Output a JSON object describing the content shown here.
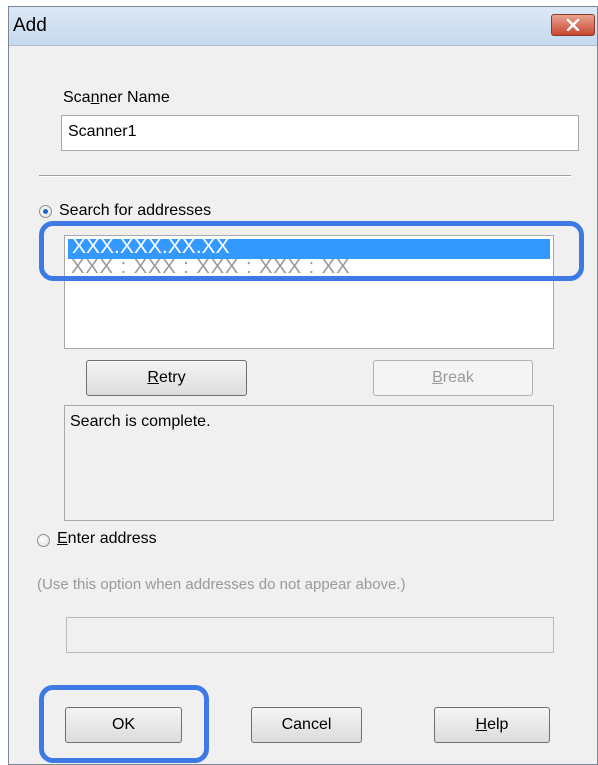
{
  "window": {
    "title": "Add"
  },
  "scanner_name": {
    "label_pre": "Sca",
    "label_mnemonic": "n",
    "label_post": "ner Name",
    "value": "Scanner1"
  },
  "search": {
    "radio_label": "Search for addresses",
    "selected": true,
    "results": [
      "XXX.XXX.XX.XX",
      "XXX : XXX : XXX : XXX : XX"
    ],
    "retry_mnemonic": "R",
    "retry_rest": "etry",
    "break_mnemonic": "B",
    "break_rest": "reak",
    "status": "Search is complete."
  },
  "enter_address": {
    "label_mnemonic": "E",
    "label_rest": "nter address",
    "selected": false,
    "hint": "(Use this option when addresses do not appear above.)",
    "value": ""
  },
  "footer": {
    "ok_label": "OK",
    "cancel_label": "Cancel",
    "help_mnemonic": "H",
    "help_rest": "elp"
  },
  "colors": {
    "selection": "#3399ff",
    "highlight_outline": "#3d7ae6",
    "dialog_bg": "#f0f0f0",
    "close_button": "#c8472f"
  },
  "icons": {
    "close": "close-icon",
    "radio_selected": "radio-selected-icon",
    "radio_unselected": "radio-unselected-icon"
  }
}
